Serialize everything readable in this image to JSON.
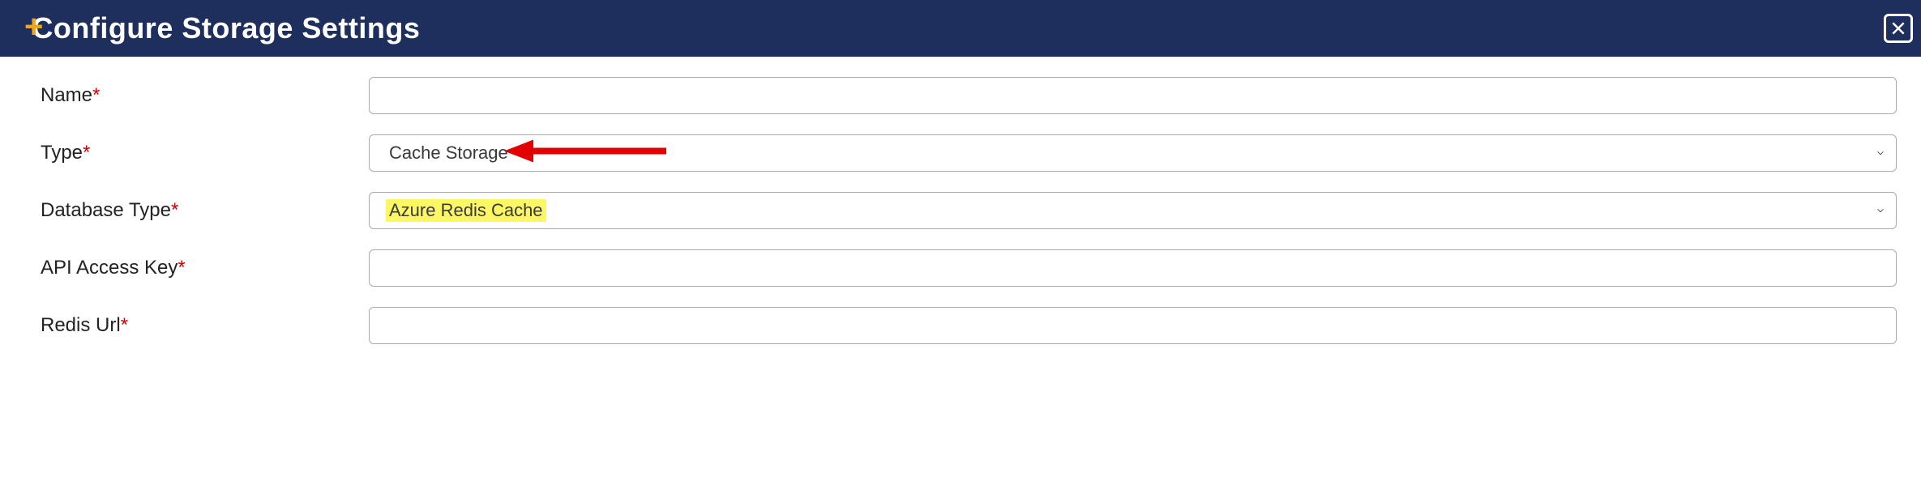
{
  "header": {
    "title": "Configure Storage Settings"
  },
  "form": {
    "name": {
      "label": "Name",
      "value": ""
    },
    "type": {
      "label": "Type",
      "selected": "Cache Storage"
    },
    "databaseType": {
      "label": "Database Type",
      "selected": "Azure Redis Cache"
    },
    "apiAccessKey": {
      "label": "API Access Key",
      "value": ""
    },
    "redisUrl": {
      "label": "Redis Url",
      "value": ""
    }
  },
  "required_marker": "*"
}
